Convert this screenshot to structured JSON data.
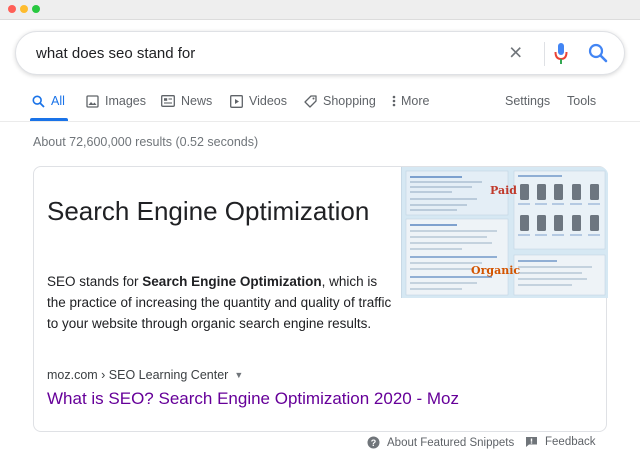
{
  "search": {
    "query": "what does seo stand for"
  },
  "tabs": [
    {
      "label": "All",
      "icon": "search-icon"
    },
    {
      "label": "Images",
      "icon": "image-icon"
    },
    {
      "label": "News",
      "icon": "news-icon"
    },
    {
      "label": "Videos",
      "icon": "video-icon"
    },
    {
      "label": "Shopping",
      "icon": "tag-icon"
    },
    {
      "label": "More",
      "icon": "more-vert-icon"
    },
    {
      "label": "Settings"
    },
    {
      "label": "Tools"
    }
  ],
  "results_stats": "About 72,600,000 results (0.52 seconds)",
  "featured_snippet": {
    "answer": "Search Engine Optimization",
    "text_before": "SEO stands for ",
    "text_bold": "Search Engine Optimization",
    "text_after": ", which is the practice of increasing the quantity and quality of traffic to your website through organic search engine results.",
    "breadcrumb": "moz.com › SEO Learning Center",
    "title": "What is SEO? Search Engine Optimization 2020 - Moz",
    "image_labels": {
      "paid": "Paid",
      "organic": "Organic"
    }
  },
  "footer": {
    "about_label": "About Featured Snippets",
    "feedback_label": "Feedback"
  },
  "colors": {
    "accent": "#1a73e8",
    "visited_link": "#660099",
    "mic_blue": "#4285f4",
    "mic_red": "#ea4335",
    "traffic_red": "#ff5f57",
    "traffic_yellow": "#febc2e",
    "traffic_green": "#28c840"
  }
}
